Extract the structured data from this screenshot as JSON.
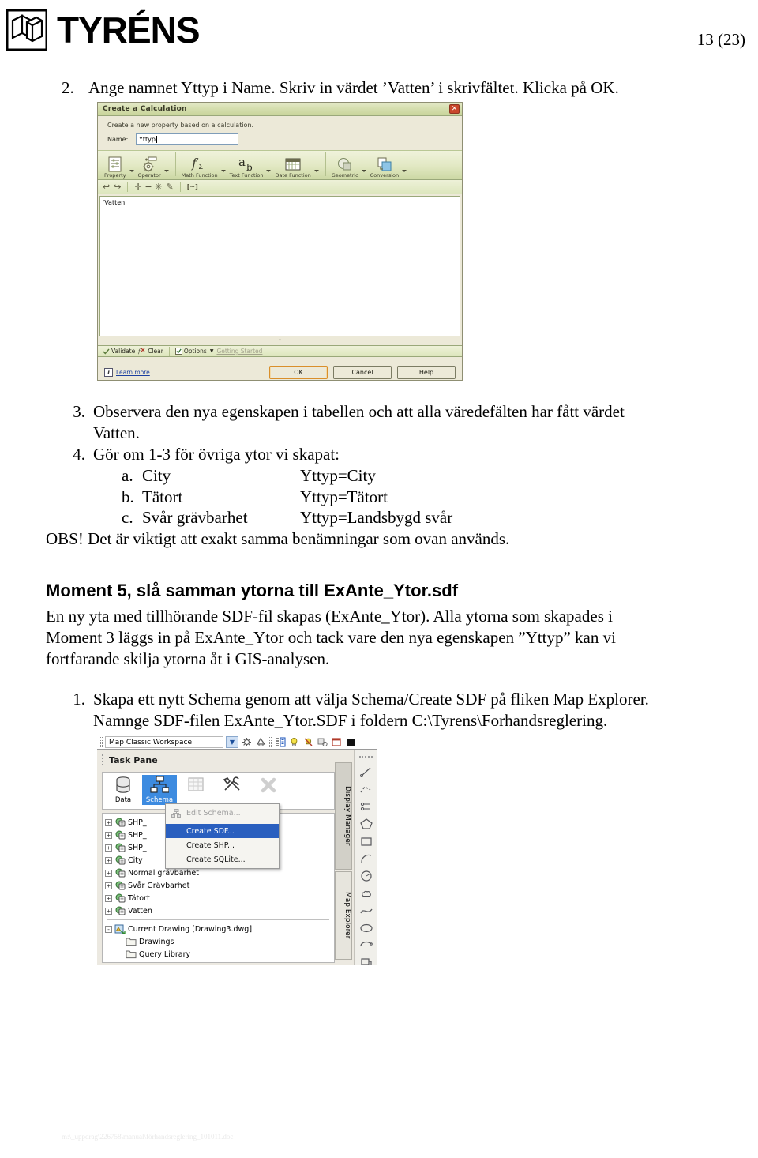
{
  "header": {
    "logo_text": "TYRÉNS",
    "logo_mark_name": "tyrens-cube-logo",
    "page_number": "13 (23)"
  },
  "steps": {
    "step2": {
      "marker": "2.",
      "text": "Ange namnet Yttyp i Name. Skriv in värdet ’Vatten’ i skrivfältet. Klicka på OK."
    },
    "step3": {
      "marker": "3.",
      "line1": "Observera den nya egenskapen i tabellen och att alla väredefälten har fått värdet",
      "line2": "Vatten."
    },
    "step4": {
      "marker": "4.",
      "text": "Gör om 1-3 för övriga ytor vi skapat:",
      "sub": [
        {
          "marker": "a.",
          "name": "City",
          "value": "Yttyp=City"
        },
        {
          "marker": "b.",
          "name": "Tätort",
          "value": "Yttyp=Tätort"
        },
        {
          "marker": "c.",
          "name": "Svår grävbarhet",
          "value": "Yttyp=Landsbygd svår"
        }
      ]
    },
    "obs": "OBS! Det är viktigt att exakt samma benämningar som ovan används."
  },
  "moment5": {
    "heading": "Moment 5, slå samman ytorna till ExAnte_Ytor.sdf",
    "para_line1": "En ny yta med tillhörande SDF-fil skapas (ExAnte_Ytor). Alla ytorna som skapades i",
    "para_line2": "Moment 3 läggs in på ExAnte_Ytor och tack vare den nya egenskapen ”Yttyp” kan vi",
    "para_line3": "fortfarande skilja ytorna åt i GIS-analysen.",
    "step1": {
      "marker": "1.",
      "line1": "Skapa ett nytt Schema genom att välja Schema/Create SDF på fliken Map Explorer.",
      "line2": "Namnge SDF-filen ExAnte_Ytor.SDF i foldern C:\\Tyrens\\Forhandsreglering."
    }
  },
  "calc_dialog": {
    "title": "Create a Calculation",
    "close_label": "✕",
    "subtitle": "Create a new property based on a calculation.",
    "name_label": "Name:",
    "name_value": "Yttyp",
    "name_placeholder": "",
    "toolbar": [
      {
        "label": "Property",
        "icon": "property-list-icon",
        "has_arrow": true
      },
      {
        "label": "Operator",
        "icon": "operator-gear-icon",
        "has_arrow": true
      },
      {
        "label": "Math Function",
        "icon": "math-function-icon",
        "has_arrow": true
      },
      {
        "label": "Text Function",
        "icon": "text-function-icon",
        "has_arrow": true
      },
      {
        "label": "Date Function",
        "icon": "date-function-icon",
        "has_arrow": true
      },
      {
        "label": "Geometric",
        "icon": "geometric-icon",
        "has_arrow": true
      },
      {
        "label": "Conversion",
        "icon": "conversion-icon",
        "has_arrow": true
      }
    ],
    "toolbar2": {
      "undo": "↩",
      "redo": "↪",
      "plus": "✛",
      "minus": "━",
      "star": "✳",
      "pencil": "✎",
      "brackets": "[~]"
    },
    "expression": "'Vatten'",
    "collapse_glyph": "⌃",
    "status": {
      "validate": "Validate",
      "clear": "Clear",
      "options": "Options",
      "getting_started": "Getting Started"
    },
    "footer": {
      "info_glyph": "i",
      "learn_more": "Learn more",
      "ok": "OK",
      "cancel": "Cancel",
      "help": "Help"
    }
  },
  "map_shot": {
    "workspace": {
      "name": "Map Classic Workspace",
      "dropdown_glyph": "▼",
      "icons": [
        "workspace-settings-icon",
        "workspace-switch-icon",
        "panel-toggle-icon",
        "lightbulb-icon",
        "lightbulb-off-icon",
        "layer-props-icon",
        "window-icon",
        "color-swatch-icon"
      ]
    },
    "task_pane": {
      "title": "Task Pane",
      "tabs": [
        {
          "label": "Data",
          "icon": "database-icon",
          "active": false
        },
        {
          "label": "Schema",
          "icon": "schema-icon",
          "active": true
        },
        {
          "label": "",
          "icon": "table-icon",
          "active": false
        },
        {
          "label": "",
          "icon": "tools-icon",
          "active": false
        },
        {
          "label": "",
          "icon": "close-x-icon",
          "active": false
        }
      ]
    },
    "context_menu": [
      {
        "label": "Edit Schema...",
        "icon": "schema-icon",
        "state": "disabled"
      },
      {
        "label": "Create SDF...",
        "icon": "",
        "state": "selected"
      },
      {
        "label": "Create SHP...",
        "icon": "",
        "state": "normal"
      },
      {
        "label": "Create SQLite...",
        "icon": "",
        "state": "normal"
      }
    ],
    "tree": [
      {
        "label": "SHP_",
        "icon": "feature-source-icon",
        "expander": "+",
        "indent": 0
      },
      {
        "label": "SHP_",
        "icon": "feature-source-icon",
        "expander": "+",
        "indent": 0
      },
      {
        "label": "SHP_",
        "icon": "feature-source-icon",
        "expander": "+",
        "indent": 0
      },
      {
        "label": "City",
        "icon": "feature-source-icon",
        "expander": "+",
        "indent": 0
      },
      {
        "label": "Normal grävbarhet",
        "icon": "feature-source-icon",
        "expander": "+",
        "indent": 0
      },
      {
        "label": "Svår Grävbarhet",
        "icon": "feature-source-icon",
        "expander": "+",
        "indent": 0
      },
      {
        "label": "Tätort",
        "icon": "feature-source-icon",
        "expander": "+",
        "indent": 0
      },
      {
        "label": "Vatten",
        "icon": "feature-source-icon",
        "expander": "+",
        "indent": 0
      }
    ],
    "tree2": [
      {
        "label": "Current Drawing [Drawing3.dwg]",
        "icon": "drawing-icon",
        "expander": "-",
        "indent": 0
      },
      {
        "label": "Drawings",
        "icon": "folder-icon",
        "expander": "",
        "indent": 1
      },
      {
        "label": "Query Library",
        "icon": "folder-icon",
        "expander": "",
        "indent": 1
      }
    ],
    "side_tabs": [
      {
        "label": "Display Manager"
      },
      {
        "label": "Map Explorer"
      }
    ]
  },
  "doc_footer": "m:\\_uppdrag\\226758\\manual\\förhandsreglering_101011.doc"
}
